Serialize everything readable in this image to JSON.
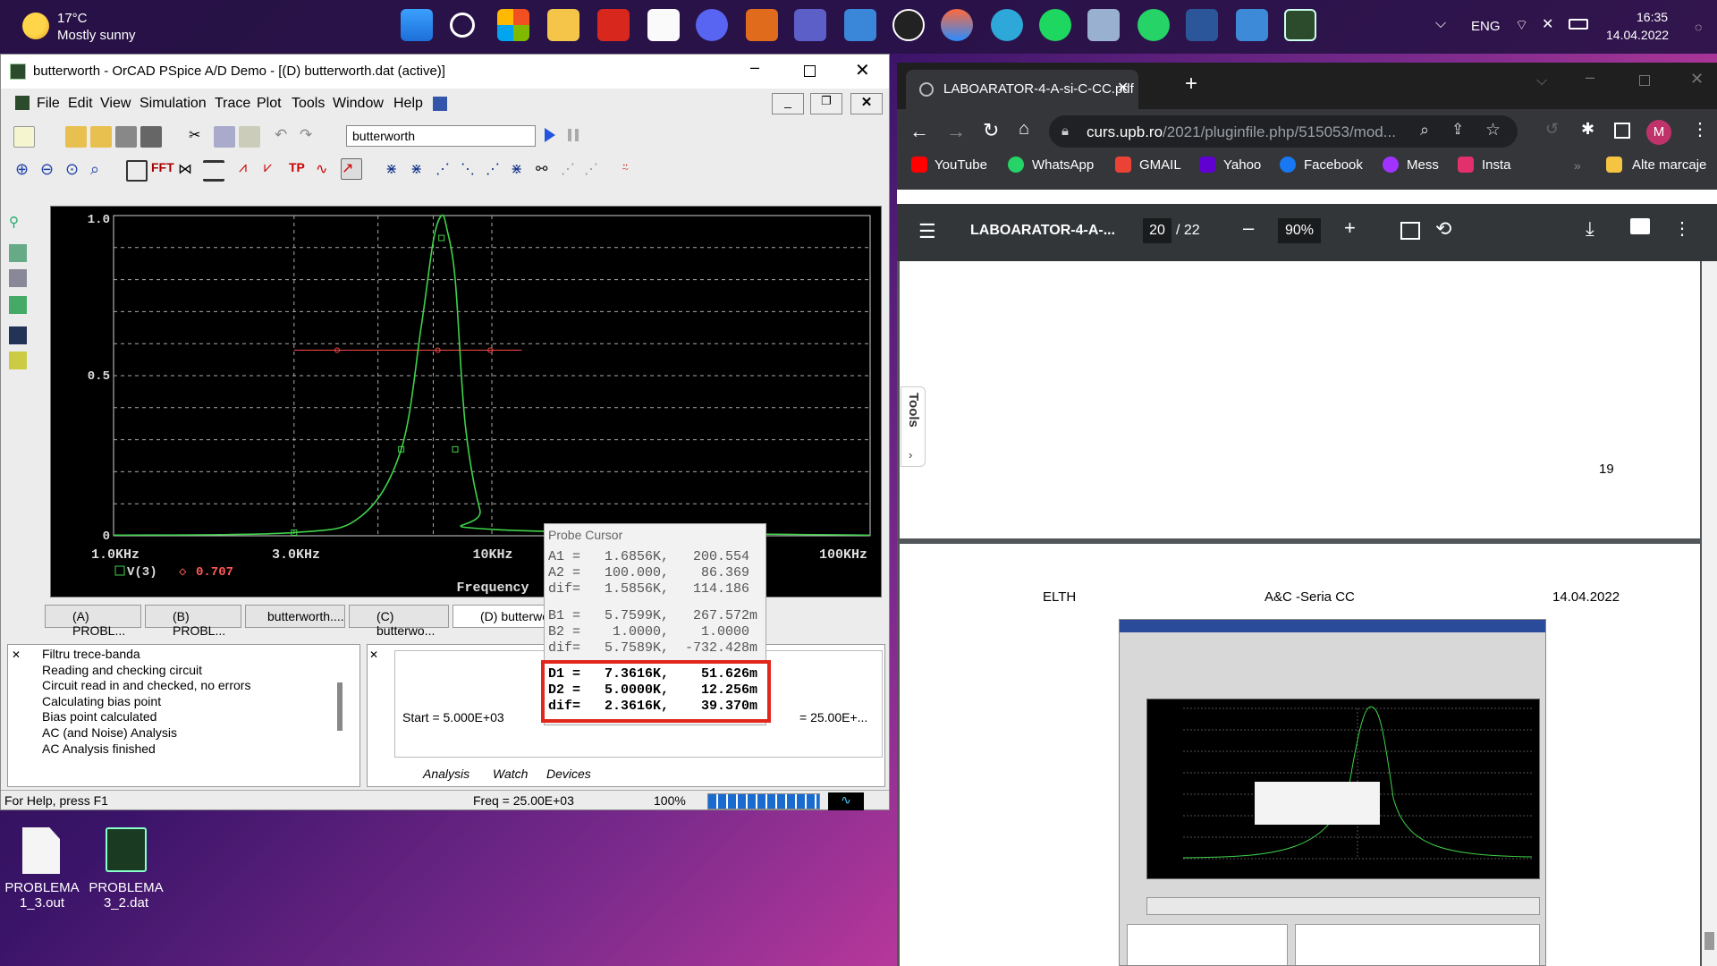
{
  "taskbar": {
    "weather_temp": "17°C",
    "weather_desc": "Mostly sunny",
    "lang": "ENG",
    "time": "16:35",
    "date": "14.04.2022",
    "icons": [
      "windows-start-icon",
      "search-icon",
      "store-icon",
      "file-explorer-icon",
      "acrobat-icon",
      "mail-icon",
      "discord-icon",
      "matlab-icon",
      "teams-icon",
      "notepad-icon",
      "obs-icon",
      "app-icon",
      "paint-icon",
      "spotify-icon",
      "virtualbox-icon",
      "whatsapp-icon",
      "word-icon",
      "photos-icon",
      "orcad-icon"
    ]
  },
  "orcad": {
    "title": "butterworth - OrCAD PSpice A/D Demo  - [(D) butterworth.dat (active)]",
    "menu": [
      "File",
      "Edit",
      "View",
      "Simulation",
      "Trace",
      "Plot",
      "Tools",
      "Window",
      "Help"
    ],
    "profile_value": "butterworth",
    "plot": {
      "y_ticks": [
        "1.0",
        "0.5",
        "0"
      ],
      "x_ticks": [
        "1.0KHz",
        "3.0KHz",
        "10KHz",
        "100KHz"
      ],
      "xlabel": "Frequency",
      "legend_trace": "V(3)",
      "legend_value": "0.707"
    },
    "doc_tabs": [
      "(A) PROBL...",
      "(B) PROBL...",
      "butterworth....",
      "(C) butterwo...",
      "(D) butterwor"
    ],
    "log_lines": [
      "Filtru trece-banda",
      "Reading and checking circuit",
      "Circuit read in and checked, no errors",
      "Calculating bias point",
      "Bias point calculated",
      "AC (and Noise) Analysis",
      "AC Analysis finished"
    ],
    "watch_start": "Start =  5.000E+03",
    "watch_end": "= 25.00E+...",
    "watch_tabs": [
      "Analysis",
      "Watch",
      "Devices"
    ],
    "status_help": "For Help, press F1",
    "status_freq": "Freq =  25.00E+03",
    "status_zoom": "100%"
  },
  "chart_data": {
    "type": "line",
    "xlabel": "Frequency",
    "xscale": "log",
    "xlim": [
      1000,
      100000
    ],
    "ylim": [
      0,
      1.0
    ],
    "series": [
      {
        "name": "V(3)",
        "x": [
          3000,
          4500,
          5760,
          6500,
          7000,
          7360,
          7600,
          8000,
          8500,
          9300,
          10000
        ],
        "y": [
          0.01,
          0.06,
          0.27,
          0.65,
          0.92,
          1.0,
          0.96,
          0.8,
          0.35,
          0.08,
          0.02
        ]
      }
    ],
    "cursor_level": 0.707
  },
  "probe": {
    "title": "Probe Cursor",
    "rows_a": [
      "A1 =   1.6856K,   200.554",
      "A2 =   100.000,    86.369",
      "dif=   1.5856K,   114.186"
    ],
    "rows_b": [
      "B1 =   5.7599K,   267.572m",
      "B2 =    1.0000,    1.0000",
      "dif=   5.7589K,  -732.428m"
    ],
    "rows_d": [
      "D1 =   7.3616K,    51.626m",
      "D2 =   5.0000K,    12.256m",
      "dif=   2.3616K,    39.370m"
    ]
  },
  "chrome": {
    "tab_title": "LABOARATOR-4-A-si-C-CC.pdf",
    "url_host": "curs.upb.ro",
    "url_path": "/2021/pluginfile.php/515053/mod...",
    "profile_letter": "M",
    "bookmarks": [
      "YouTube",
      "WhatsApp",
      "GMAIL",
      "Yahoo",
      "Facebook",
      "Mess",
      "Insta"
    ],
    "bookmarks_other": "Alte marcaje",
    "pdf_title": "LABOARATOR-4-A-...",
    "page_current": "20",
    "page_total": "/ 22",
    "zoom": "90%",
    "tools_label": "Tools",
    "page19_number": "19",
    "header_left": "ELTH",
    "header_center": "A&C -Seria CC",
    "header_right": "14.04.2022"
  },
  "desktop": {
    "file1": "PROBLEMA 1_3.out",
    "file2": "PROBLEMA 3_2.dat"
  }
}
